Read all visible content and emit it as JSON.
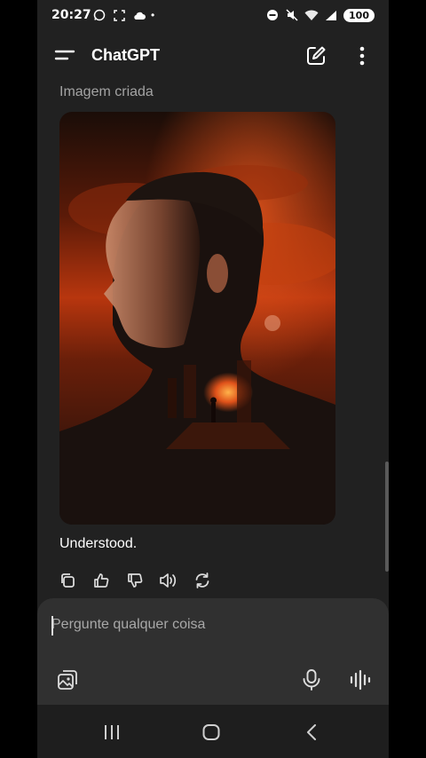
{
  "status_bar": {
    "time": "20:27",
    "battery": "100",
    "dot": "•"
  },
  "header": {
    "title": "ChatGPT"
  },
  "conversation": {
    "image_label": "Imagem criada",
    "reply_text": "Understood."
  },
  "composer": {
    "placeholder": "Pergunte qualquer coisa"
  },
  "colors": {
    "background": "#212121",
    "composer": "#303030",
    "accent_fire": "#e0521a"
  },
  "icons": [
    "menu-icon",
    "edit-icon",
    "more-vertical-icon",
    "copy-icon",
    "thumbs-up-icon",
    "thumbs-down-icon",
    "read-aloud-icon",
    "regenerate-icon",
    "attach-image-icon",
    "microphone-icon",
    "voice-mode-icon",
    "recent-apps-icon",
    "home-icon",
    "back-icon"
  ]
}
